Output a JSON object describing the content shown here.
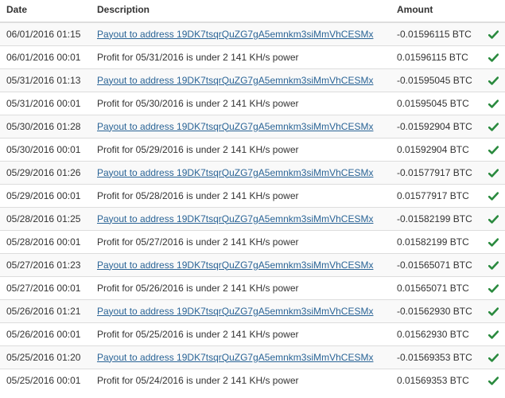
{
  "table": {
    "headers": {
      "date": "Date",
      "description": "Description",
      "amount": "Amount",
      "status": ""
    },
    "status_icon": "check-icon",
    "status_color": "#2a8a3e",
    "link_color": "#2a6496",
    "rows": [
      {
        "date": "06/01/2016 01:15",
        "description": "Payout to address 19DK7tsqrQuZG7gA5emnkm3siMmVhCESMx",
        "link": true,
        "amount": "-0.01596115 BTC"
      },
      {
        "date": "06/01/2016 00:01",
        "description": "Profit for 05/31/2016 is under 2 141 KH/s power",
        "link": false,
        "amount": "0.01596115 BTC"
      },
      {
        "date": "05/31/2016 01:13",
        "description": "Payout to address 19DK7tsqrQuZG7gA5emnkm3siMmVhCESMx",
        "link": true,
        "amount": "-0.01595045 BTC"
      },
      {
        "date": "05/31/2016 00:01",
        "description": "Profit for 05/30/2016 is under 2 141 KH/s power",
        "link": false,
        "amount": "0.01595045 BTC"
      },
      {
        "date": "05/30/2016 01:28",
        "description": "Payout to address 19DK7tsqrQuZG7gA5emnkm3siMmVhCESMx",
        "link": true,
        "amount": "-0.01592904 BTC"
      },
      {
        "date": "05/30/2016 00:01",
        "description": "Profit for 05/29/2016 is under 2 141 KH/s power",
        "link": false,
        "amount": "0.01592904 BTC"
      },
      {
        "date": "05/29/2016 01:26",
        "description": "Payout to address 19DK7tsqrQuZG7gA5emnkm3siMmVhCESMx",
        "link": true,
        "amount": "-0.01577917 BTC"
      },
      {
        "date": "05/29/2016 00:01",
        "description": "Profit for 05/28/2016 is under 2 141 KH/s power",
        "link": false,
        "amount": "0.01577917 BTC"
      },
      {
        "date": "05/28/2016 01:25",
        "description": "Payout to address 19DK7tsqrQuZG7gA5emnkm3siMmVhCESMx",
        "link": true,
        "amount": "-0.01582199 BTC"
      },
      {
        "date": "05/28/2016 00:01",
        "description": "Profit for 05/27/2016 is under 2 141 KH/s power",
        "link": false,
        "amount": "0.01582199 BTC"
      },
      {
        "date": "05/27/2016 01:23",
        "description": "Payout to address 19DK7tsqrQuZG7gA5emnkm3siMmVhCESMx",
        "link": true,
        "amount": "-0.01565071 BTC"
      },
      {
        "date": "05/27/2016 00:01",
        "description": "Profit for 05/26/2016 is under 2 141 KH/s power",
        "link": false,
        "amount": "0.01565071 BTC"
      },
      {
        "date": "05/26/2016 01:21",
        "description": "Payout to address 19DK7tsqrQuZG7gA5emnkm3siMmVhCESMx",
        "link": true,
        "amount": "-0.01562930 BTC"
      },
      {
        "date": "05/26/2016 00:01",
        "description": "Profit for 05/25/2016 is under 2 141 KH/s power",
        "link": false,
        "amount": "0.01562930 BTC"
      },
      {
        "date": "05/25/2016 01:20",
        "description": "Payout to address 19DK7tsqrQuZG7gA5emnkm3siMmVhCESMx",
        "link": true,
        "amount": "-0.01569353 BTC"
      },
      {
        "date": "05/25/2016 00:01",
        "description": "Profit for 05/24/2016 is under 2 141 KH/s power",
        "link": false,
        "amount": "0.01569353 BTC"
      }
    ]
  }
}
